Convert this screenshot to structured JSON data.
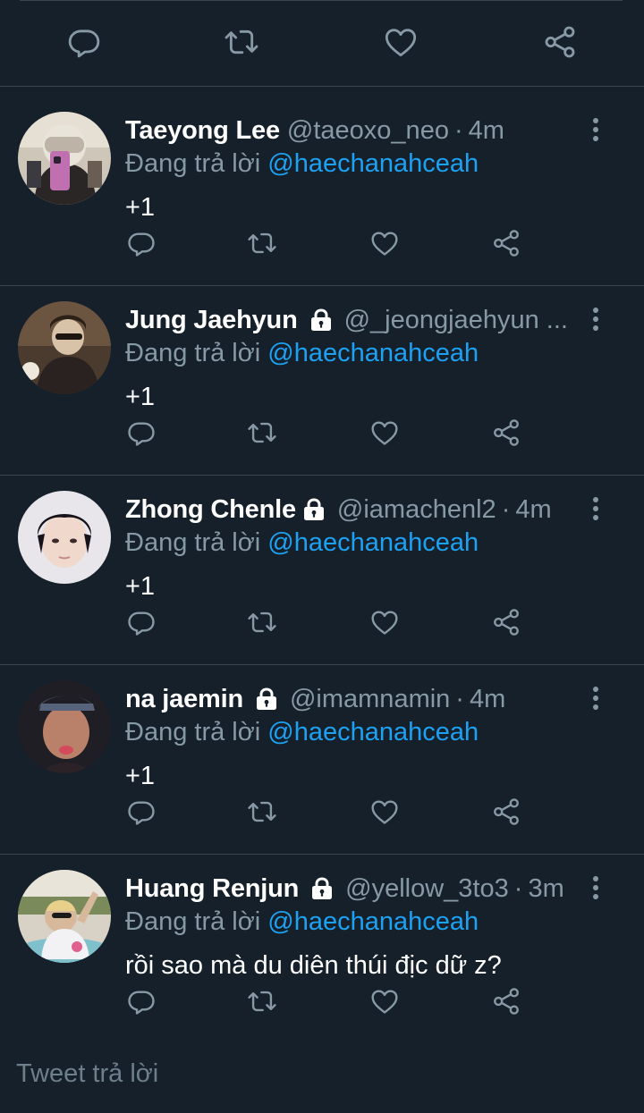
{
  "replying_prefix": "Đang trả lời",
  "replies": [
    {
      "name": "Taeyong Lee",
      "protected": false,
      "handle": "@taeoxo_neo",
      "separator": "·",
      "time": "4m",
      "mention": "@haechanahceah",
      "text": "+1"
    },
    {
      "name": "Jung Jaehyun",
      "protected": true,
      "handle": "@_jeongjaehyun ...",
      "separator": "",
      "time": "",
      "mention": "@haechanahceah",
      "text": "+1"
    },
    {
      "name": "Zhong Chenle",
      "protected": true,
      "handle": "@iamachenl2",
      "separator": "·",
      "time": "4m",
      "mention": "@haechanahceah",
      "text": "+1"
    },
    {
      "name": "na jaemin",
      "protected": true,
      "handle": "@imamnamin",
      "separator": "·",
      "time": "4m",
      "mention": "@haechanahceah",
      "text": "+1"
    },
    {
      "name": "Huang Renjun",
      "protected": true,
      "handle": "@yellow_3to3",
      "separator": "·",
      "time": "3m",
      "mention": "@haechanahceah",
      "text": "rồi sao mà du diên thúi địc dữ z?"
    }
  ],
  "compose": {
    "placeholder": "Tweet trả lời"
  },
  "colors": {
    "background": "#15202b",
    "divider": "#38444d",
    "secondary_text": "#8899a6",
    "link": "#1da1f2",
    "primary_text": "#ffffff"
  },
  "icons": [
    "reply-icon",
    "retweet-icon",
    "like-icon",
    "share-icon",
    "more-vertical-icon",
    "lock-icon"
  ]
}
